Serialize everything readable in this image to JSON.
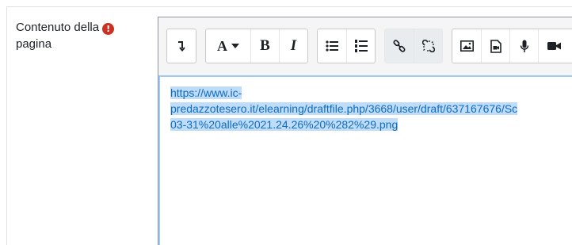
{
  "field": {
    "label_line1": "Contenuto della",
    "label_line2": "pagina",
    "required_icon": "exclamation-circle-icon"
  },
  "toolbar": {
    "groups": [
      {
        "buttons": [
          {
            "name": "collapse-toolbar",
            "icon": "arrow-down-corner-icon"
          }
        ]
      },
      {
        "buttons": [
          {
            "name": "paragraph-style",
            "icon": "font-style-icon",
            "label": "A"
          },
          {
            "name": "bold",
            "icon": "bold-icon",
            "label": "B"
          },
          {
            "name": "italic",
            "icon": "italic-icon",
            "label": "I"
          }
        ]
      },
      {
        "buttons": [
          {
            "name": "unordered-list",
            "icon": "bullet-list-icon"
          },
          {
            "name": "ordered-list",
            "icon": "numbered-list-icon"
          }
        ]
      },
      {
        "buttons": [
          {
            "name": "link",
            "icon": "link-icon"
          },
          {
            "name": "unlink",
            "icon": "unlink-icon"
          }
        ]
      },
      {
        "buttons": [
          {
            "name": "insert-image",
            "icon": "image-icon"
          },
          {
            "name": "insert-media",
            "icon": "media-file-icon"
          },
          {
            "name": "record-audio",
            "icon": "microphone-icon"
          },
          {
            "name": "record-video",
            "icon": "video-camera-icon"
          }
        ]
      }
    ]
  },
  "editor": {
    "lines": [
      "https://www.ic-",
      "predazzotesero.it/elearning/draftfile.php/3668/user/draft/637167676/Sc",
      "03-31%20alle%2021.24.26%20%282%29.png"
    ],
    "link_color": "#0f6cbf",
    "selection_color": "#bfdcf8"
  }
}
